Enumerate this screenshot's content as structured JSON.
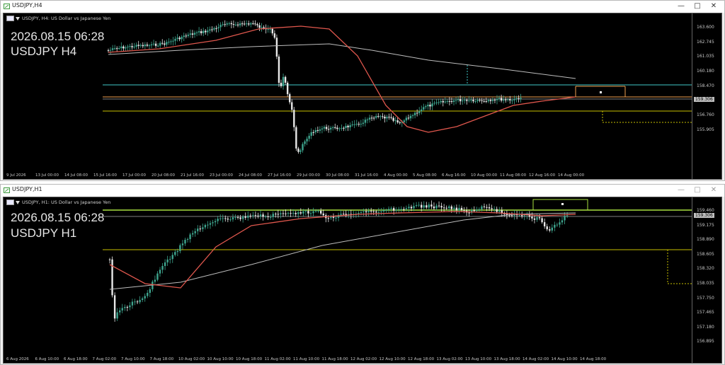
{
  "top": {
    "window_title": "USDJPY,H4",
    "symbol_desc": "USDJPY, H4:  US Dollar vs Japanese Yen",
    "big_date": "2026.08.15 06:28",
    "big_label": "USDJPY H4",
    "price_tag": "159.306",
    "y_ticks": [
      "163.600",
      "162.745",
      "161.035",
      "160.180",
      "158.470",
      "157.615",
      "156.760",
      "155.905"
    ],
    "x_ticks": [
      "9 Jul 2026",
      "13 Jul 00:00",
      "14 Jul 08:00",
      "15 Jul 16:00",
      "17 Jul 00:00",
      "20 Jul 08:00",
      "21 Jul 16:00",
      "23 Jul 00:00",
      "24 Jul 08:00",
      "27 Jul 16:00",
      "29 Jul 00:00",
      "30 Jul 08:00",
      "31 Jul 16:00",
      "4 Aug 00:00",
      "5 Aug 08:00",
      "6 Aug 16:00",
      "10 Aug 00:00",
      "11 Aug 08:00",
      "12 Aug 16:00",
      "14 Aug 00:00"
    ]
  },
  "bottom": {
    "window_title": "USDJPY,H1",
    "symbol_desc": "USDJPY, H1:  US Dollar vs Japanese Yen",
    "big_date": "2026.08.15 06:28",
    "big_label": "USDJPY H1",
    "price_tag": "159.306",
    "y_ticks": [
      "159.460",
      "159.175",
      "158.890",
      "158.605",
      "158.320",
      "158.035",
      "157.750",
      "157.465",
      "157.180",
      "156.895"
    ],
    "x_ticks": [
      "6 Aug 2026",
      "6 Aug 10:00",
      "6 Aug 18:00",
      "7 Aug 02:00",
      "7 Aug 10:00",
      "7 Aug 18:00",
      "10 Aug 02:00",
      "10 Aug 10:00",
      "10 Aug 18:00",
      "11 Aug 02:00",
      "11 Aug 10:00",
      "11 Aug 18:00",
      "12 Aug 02:00",
      "12 Aug 10:00",
      "12 Aug 18:00",
      "13 Aug 02:00",
      "13 Aug 10:00",
      "13 Aug 18:00",
      "14 Aug 02:00",
      "14 Aug 10:00",
      "14 Aug 18:00"
    ]
  },
  "controls": {
    "minimize": "—",
    "restore": "□",
    "close": "✕"
  },
  "colors": {
    "bull": "#3ea58e",
    "bear": "#e8e8e8",
    "ma_fast": "#e0574d",
    "ma_slow": "#bdbdbd",
    "line_orange": "#f0a050",
    "line_yellow": "#c8c000",
    "line_cyan": "#40c8c8",
    "line_green": "#a8e040"
  },
  "icons": [
    "chart-window-icon",
    "usd-jpy-flag-icon",
    "dropdown-triangle-icon"
  ]
}
